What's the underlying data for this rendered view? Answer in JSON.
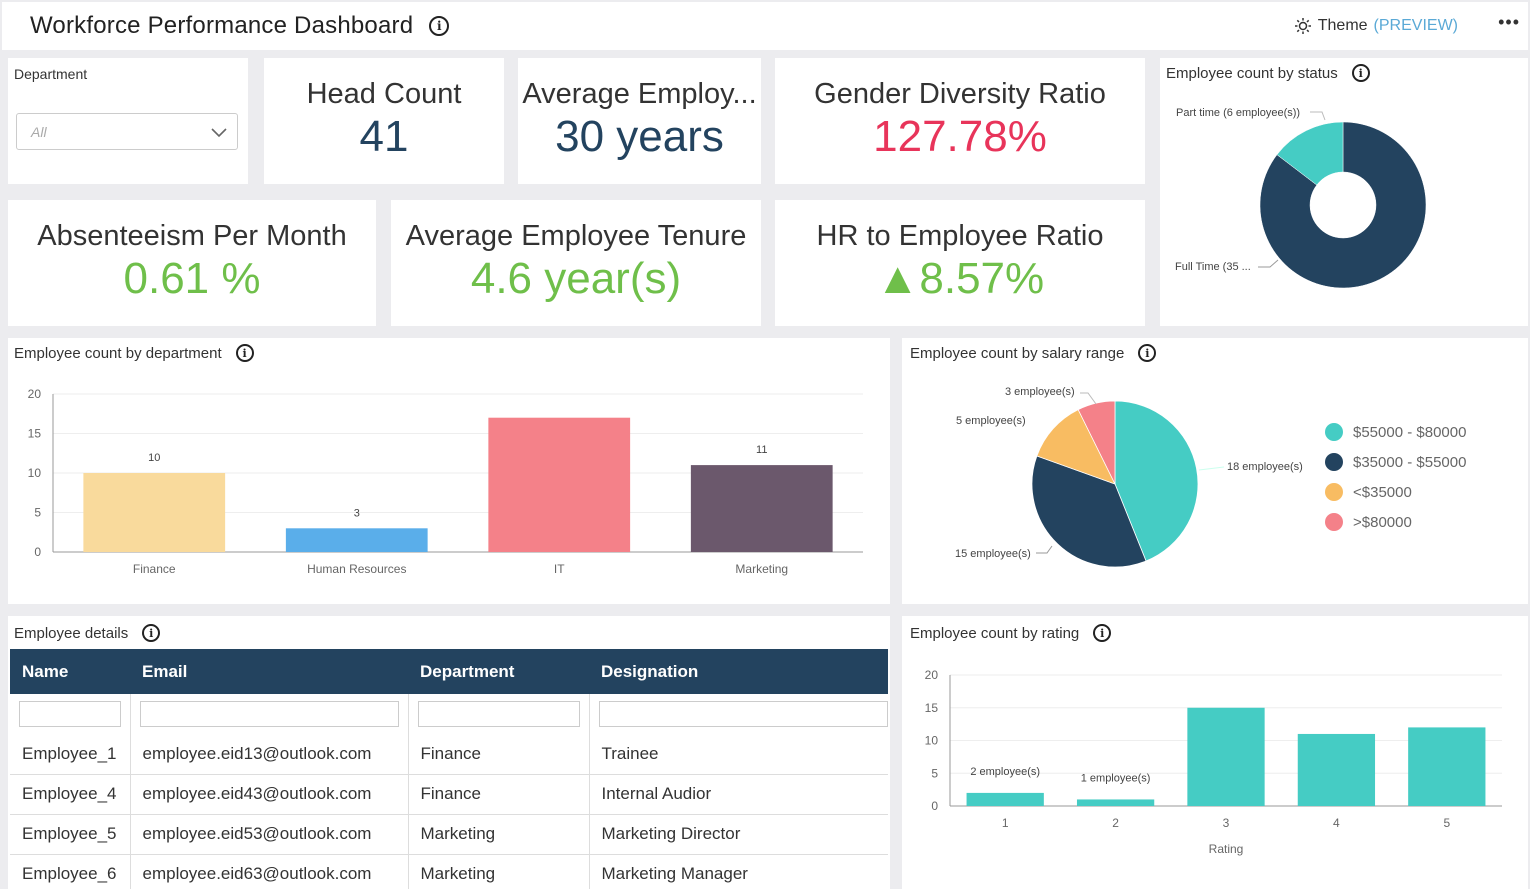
{
  "header": {
    "title": "Workforce Performance Dashboard",
    "theme_label": "Theme",
    "theme_preview": "(PREVIEW)",
    "more_label": "•••"
  },
  "filter": {
    "label": "Department",
    "selected": "All"
  },
  "kpis": [
    {
      "label": "Head Count",
      "value": "41",
      "color": "#23435f"
    },
    {
      "label": "Average Employ...",
      "value": "30 years",
      "color": "#23435f"
    },
    {
      "label": "Gender Diversity Ratio",
      "value": "127.78%",
      "color": "#e8345a"
    },
    {
      "label": "Absenteeism Per Month",
      "value": "0.61 %",
      "color": "#6fbf4a"
    },
    {
      "label": "Average Employee Tenure",
      "value": "4.6 year(s)",
      "color": "#6fbf4a"
    },
    {
      "label": "HR to Employee Ratio",
      "value": "▲8.57%",
      "color": "#6fbf4a"
    }
  ],
  "panels": {
    "status": "Employee count by status",
    "department": "Employee count by department",
    "salary": "Employee count by salary range",
    "details": "Employee details",
    "rating": "Employee count by rating"
  },
  "chart_data": [
    {
      "id": "status",
      "type": "pie",
      "donut": true,
      "title": "Employee count by status",
      "labels": [
        "Part time",
        "Full Time"
      ],
      "values": [
        6,
        35
      ],
      "data_labels": [
        "Part time (6 employee(s))",
        "Full Time (35 ..."
      ],
      "colors": [
        "#45ccc4",
        "#23435f"
      ]
    },
    {
      "id": "department",
      "type": "bar",
      "title": "Employee count by department",
      "categories": [
        "Finance",
        "Human Resources",
        "IT",
        "Marketing"
      ],
      "values": [
        10,
        3,
        17,
        11
      ],
      "data_labels": [
        "10",
        "3",
        "",
        "11"
      ],
      "colors": [
        "#f9da9c",
        "#5aaeea",
        "#f48189",
        "#6b586c"
      ],
      "ylim": [
        0,
        20
      ],
      "yticks": [
        0,
        5,
        10,
        15,
        20
      ],
      "grid": true
    },
    {
      "id": "salary",
      "type": "pie",
      "title": "Employee count by salary range",
      "labels": [
        "$55000 - $80000",
        "$35000 - $55000",
        "<$35000",
        ">$80000"
      ],
      "values": [
        18,
        15,
        5,
        3
      ],
      "data_labels": [
        "18 employee(s)",
        "15 employee(s)",
        "5 employee(s)",
        "3 employee(s)"
      ],
      "colors": [
        "#45ccc4",
        "#23435f",
        "#f8bc62",
        "#f48189"
      ],
      "legend": "right"
    },
    {
      "id": "rating",
      "type": "bar",
      "title": "Employee count by rating",
      "xlabel": "Rating",
      "categories": [
        "1",
        "2",
        "3",
        "4",
        "5"
      ],
      "values": [
        2,
        1,
        15,
        11,
        12
      ],
      "data_labels": [
        "2 employee(s)",
        "1 employee(s)",
        "",
        "",
        ""
      ],
      "color": "#45ccc4",
      "ylim": [
        0,
        20
      ],
      "yticks": [
        0,
        5,
        10,
        15,
        20
      ],
      "grid": true
    }
  ],
  "table": {
    "columns": [
      "Name",
      "Email",
      "Department",
      "Designation"
    ],
    "rows": [
      [
        "Employee_1",
        "employee.eid13@outlook.com",
        "Finance",
        "Trainee"
      ],
      [
        "Employee_4",
        "employee.eid43@outlook.com",
        "Finance",
        "Internal Audior"
      ],
      [
        "Employee_5",
        "employee.eid53@outlook.com",
        "Marketing",
        "Marketing Director"
      ],
      [
        "Employee_6",
        "employee.eid63@outlook.com",
        "Marketing",
        "Marketing Manager"
      ]
    ]
  }
}
